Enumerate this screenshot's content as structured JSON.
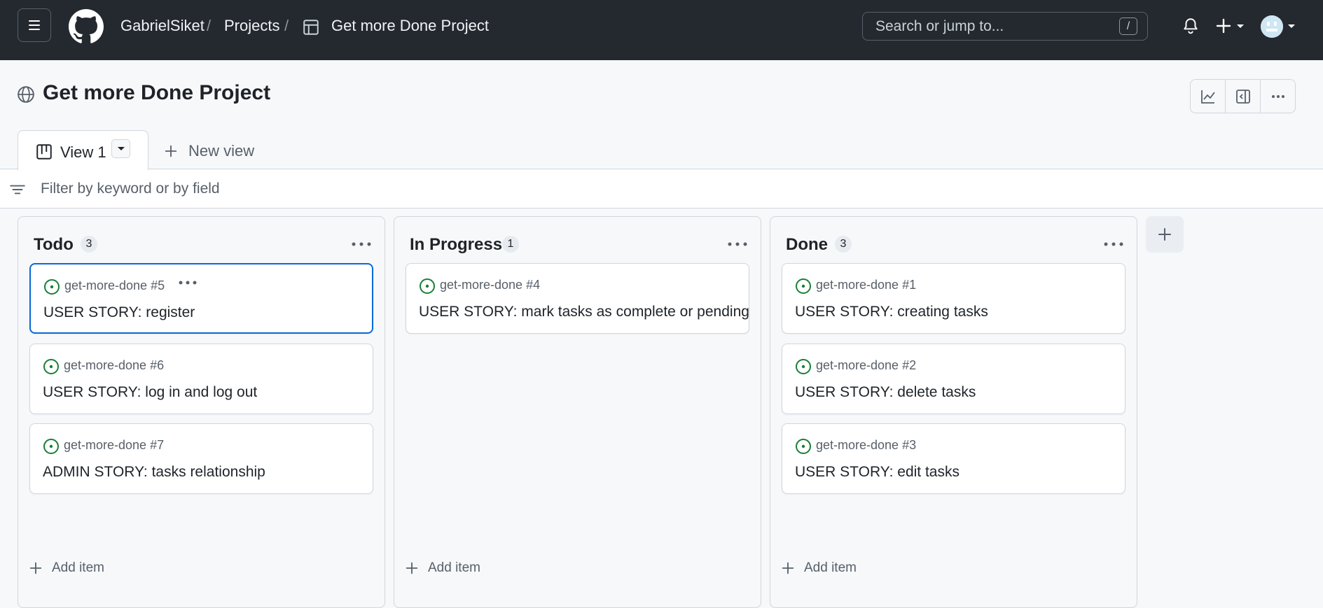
{
  "topbar": {
    "breadcrumbs": [
      "GabrielSiket",
      "Projects",
      "Get more Done Project"
    ],
    "separator": "/",
    "search_placeholder": "Search or jump to...",
    "search_shortcut": "/"
  },
  "project": {
    "title": "Get more Done Project"
  },
  "tabs": [
    {
      "label": "View 1",
      "active": true
    }
  ],
  "new_view_label": "New view",
  "filter": {
    "placeholder": "Filter by keyword or by field"
  },
  "colors": {
    "issue_open": "#1a7f37",
    "selected_border": "#0969da",
    "topbar_bg": "#24292f"
  },
  "columns": [
    {
      "title": "Todo",
      "count": "3",
      "add_item_label": "Add item",
      "cards": [
        {
          "ref": "get-more-done #5",
          "title": "USER STORY: register"
        },
        {
          "ref": "get-more-done #6",
          "title": "USER STORY: log in and log out"
        },
        {
          "ref": "get-more-done #7",
          "title": "ADMIN STORY: tasks relationship"
        }
      ]
    },
    {
      "title": "In Progress",
      "count": "1",
      "add_item_label": "Add item",
      "cards": [
        {
          "ref": "get-more-done #4",
          "title": "USER STORY: mark tasks as complete or pending"
        }
      ]
    },
    {
      "title": "Done",
      "count": "3",
      "add_item_label": "Add item",
      "cards": [
        {
          "ref": "get-more-done #1",
          "title": "USER STORY: creating tasks"
        },
        {
          "ref": "get-more-done #2",
          "title": "USER STORY: delete tasks"
        },
        {
          "ref": "get-more-done #3",
          "title": "USER STORY: edit tasks"
        }
      ]
    }
  ]
}
